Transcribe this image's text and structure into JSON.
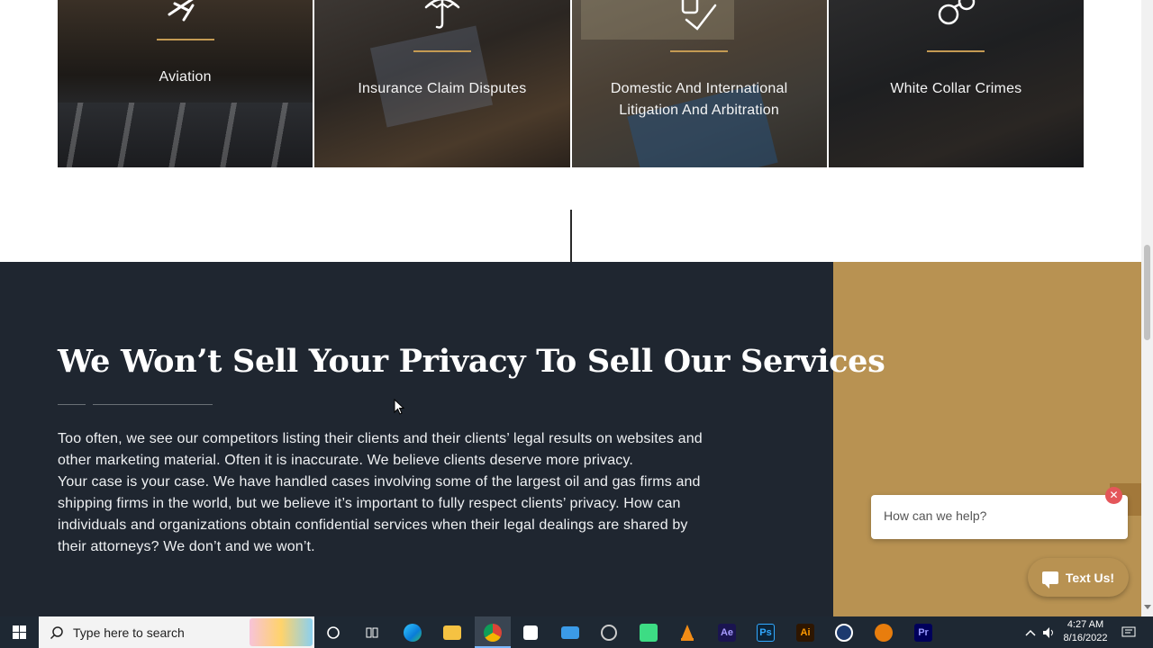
{
  "practice_areas": [
    {
      "label": "Aviation",
      "icon": "airplane-icon"
    },
    {
      "label": "Insurance Claim Disputes",
      "icon": "umbrella-icon"
    },
    {
      "label": "Domestic And International Litigation And Arbitration",
      "icon": "document-check-icon"
    },
    {
      "label": "White Collar Crimes",
      "icon": "handcuffs-icon"
    }
  ],
  "privacy": {
    "heading": "We Won’t Sell Your Privacy To Sell Our Services",
    "paragraph1": "Too often, we see our competitors listing their clients and their clients’ legal results on websites and other marketing material. Often it is inaccurate. We believe clients deserve more privacy.",
    "paragraph2": "Your case is your case. We have handled cases involving some of the largest oil and gas firms and shipping firms in the world, but we believe it’s important to fully respect clients’ privacy. How can individuals and organizations obtain confidential services when their legal dealings are shared by their attorneys? We don’t and we won’t."
  },
  "chat": {
    "prompt": "How can we help?",
    "close_symbol": "✕",
    "text_us_label": "Text Us!"
  },
  "taskbar": {
    "search_placeholder": "Type here to search",
    "apps": [
      "cortana-icon",
      "task-view-icon",
      "edge-icon",
      "file-explorer-icon",
      "chrome-icon",
      "store-icon",
      "mail-icon",
      "app-icon",
      "android-icon",
      "vlc-icon",
      "after-effects-icon",
      "photoshop-icon",
      "illustrator-icon",
      "cinema4d-icon",
      "blender-icon",
      "premiere-icon"
    ],
    "app_labels": {
      "after_effects": "Ae",
      "photoshop": "Ps",
      "illustrator": "Ai",
      "premiere": "Pr"
    },
    "time": "4:27 AM",
    "date": "8/16/2022"
  },
  "colors": {
    "accent_gold": "#b89252",
    "dark_section": "#1f2630",
    "rule_gold": "#c49a53"
  }
}
